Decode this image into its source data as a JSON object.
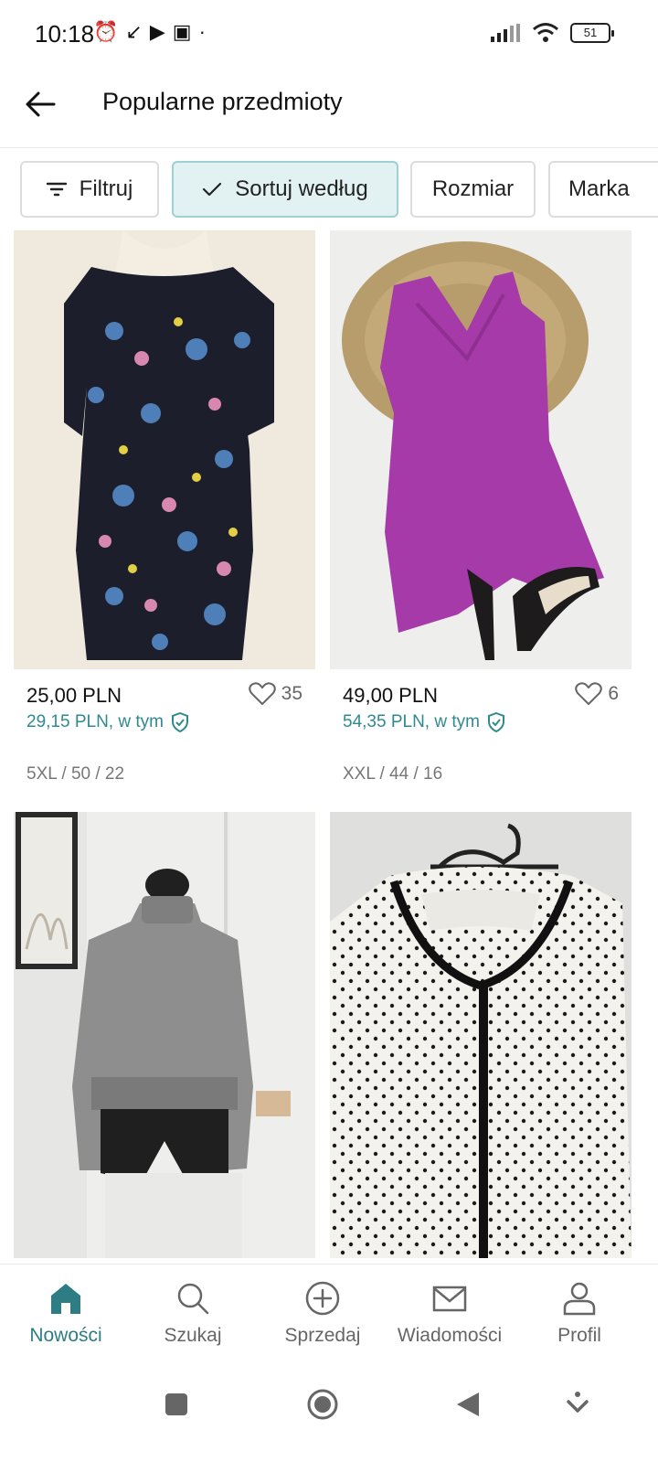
{
  "status_bar": {
    "time": "10:18",
    "battery": "51"
  },
  "header": {
    "title": "Popularne przedmioty"
  },
  "filters": [
    {
      "label": "Filtruj",
      "icon": "filter-icon",
      "active": false
    },
    {
      "label": "Sortuj według",
      "icon": "check-icon",
      "active": true
    },
    {
      "label": "Rozmiar",
      "active": false
    },
    {
      "label": "Marka",
      "active": false
    }
  ],
  "items": [
    {
      "price": "25,00 PLN",
      "buyer_price": "29,15 PLN, w tym",
      "likes": "35",
      "size": "5XL / 50 / 22",
      "image": "floral-dress"
    },
    {
      "price": "49,00 PLN",
      "buyer_price": "54,35 PLN, w tym",
      "likes": "6",
      "size": "XXL / 44 / 16",
      "image": "purple-dress"
    },
    {
      "image": "grey-sweater"
    },
    {
      "image": "polka-dot-cardigan"
    }
  ],
  "bottom_nav": [
    {
      "label": "Nowości",
      "icon": "home-icon",
      "active": true
    },
    {
      "label": "Szukaj",
      "icon": "search-icon",
      "active": false
    },
    {
      "label": "Sprzedaj",
      "icon": "plus-circle-icon",
      "active": false
    },
    {
      "label": "Wiadomości",
      "icon": "mail-icon",
      "active": false
    },
    {
      "label": "Profil",
      "icon": "profile-icon",
      "active": false
    }
  ],
  "colors": {
    "accent": "#2e7d85",
    "active_chip_bg": "#e2f2f3"
  }
}
